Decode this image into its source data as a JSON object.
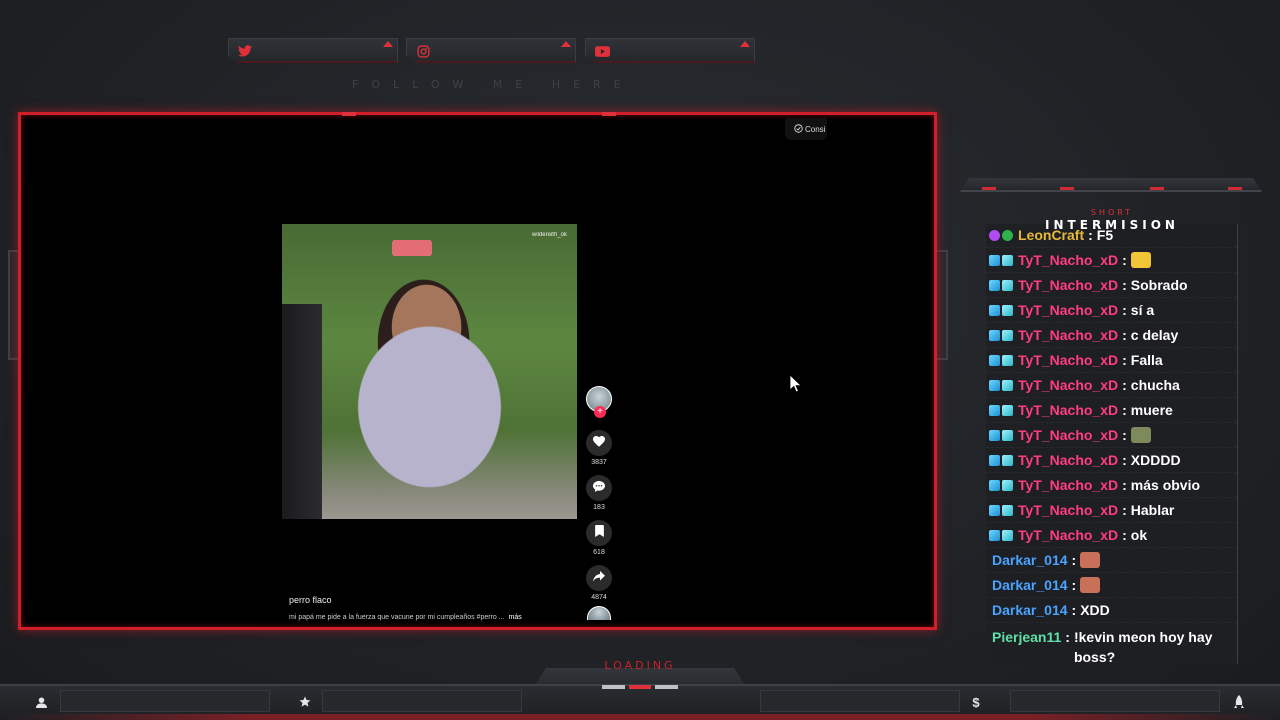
{
  "social": {
    "follow_label": "FOLLOW ME HERE",
    "items": [
      {
        "icon": "twitter-icon",
        "color": "#e0303a"
      },
      {
        "icon": "instagram-icon",
        "color": "#e0303a"
      },
      {
        "icon": "youtube-icon",
        "color": "#e0303a"
      }
    ]
  },
  "player": {
    "top_button_label": "Consi",
    "thumbnail_watermark": "wildereith_ok",
    "video_title": "perro flaco",
    "video_description": "mi papá me pide a la fuerza que vacune por mi cumpleaños #perro ...",
    "more_label": "más",
    "likes": "3837",
    "comments": "183",
    "saves": "618",
    "shares": "4874"
  },
  "chat": {
    "header_sub": "SHORT",
    "header_main": "INTERMISION",
    "messages": [
      {
        "user": "LeonCraft",
        "color": "#e8b93c",
        "text": "F5",
        "badges": [
          "bits",
          "verif"
        ],
        "emote": null
      },
      {
        "user": "TyT_Nacho_xD",
        "color": "#ff3d7f",
        "text": "",
        "badges": [
          "cube",
          "sub"
        ],
        "emote": "#f2c438"
      },
      {
        "user": "TyT_Nacho_xD",
        "color": "#ff3d7f",
        "text": "Sobrado",
        "badges": [
          "cube",
          "sub"
        ],
        "emote": null
      },
      {
        "user": "TyT_Nacho_xD",
        "color": "#ff3d7f",
        "text": "sí a",
        "badges": [
          "cube",
          "sub"
        ],
        "emote": null
      },
      {
        "user": "TyT_Nacho_xD",
        "color": "#ff3d7f",
        "text": "c delay",
        "badges": [
          "cube",
          "sub"
        ],
        "emote": null
      },
      {
        "user": "TyT_Nacho_xD",
        "color": "#ff3d7f",
        "text": "Falla",
        "badges": [
          "cube",
          "sub"
        ],
        "emote": null
      },
      {
        "user": "TyT_Nacho_xD",
        "color": "#ff3d7f",
        "text": "chucha",
        "badges": [
          "cube",
          "sub"
        ],
        "emote": null
      },
      {
        "user": "TyT_Nacho_xD",
        "color": "#ff3d7f",
        "text": "muere",
        "badges": [
          "cube",
          "sub"
        ],
        "emote": null
      },
      {
        "user": "TyT_Nacho_xD",
        "color": "#ff3d7f",
        "text": "",
        "badges": [
          "cube",
          "sub"
        ],
        "emote": "#7c8a5c"
      },
      {
        "user": "TyT_Nacho_xD",
        "color": "#ff3d7f",
        "text": "XDDDD",
        "badges": [
          "cube",
          "sub"
        ],
        "emote": null
      },
      {
        "user": "TyT_Nacho_xD",
        "color": "#ff3d7f",
        "text": "más obvio",
        "badges": [
          "cube",
          "sub"
        ],
        "emote": null
      },
      {
        "user": "TyT_Nacho_xD",
        "color": "#ff3d7f",
        "text": "Hablar",
        "badges": [
          "cube",
          "sub"
        ],
        "emote": null
      },
      {
        "user": "TyT_Nacho_xD",
        "color": "#ff3d7f",
        "text": "ok",
        "badges": [
          "cube",
          "sub"
        ],
        "emote": null
      },
      {
        "user": "Darkar_014",
        "color": "#4aa3ff",
        "text": "",
        "badges": [],
        "emote": "#c8705a"
      },
      {
        "user": "Darkar_014",
        "color": "#4aa3ff",
        "text": "",
        "badges": [],
        "emote": "#c8705a"
      },
      {
        "user": "Darkar_014",
        "color": "#4aa3ff",
        "text": "XDD",
        "badges": [],
        "emote": null
      },
      {
        "user": "Pierjean11",
        "color": "#5fe0a8",
        "text": "!kevin meon hoy hay boss?",
        "badges": [],
        "emote": null
      }
    ]
  },
  "bottom": {
    "loading_label": "LOADING",
    "icons": [
      "user-icon",
      "star-icon",
      "dollar-icon",
      "rocket-icon"
    ]
  },
  "colors": {
    "accent": "#d01f28",
    "frame_bg": "#000000"
  }
}
